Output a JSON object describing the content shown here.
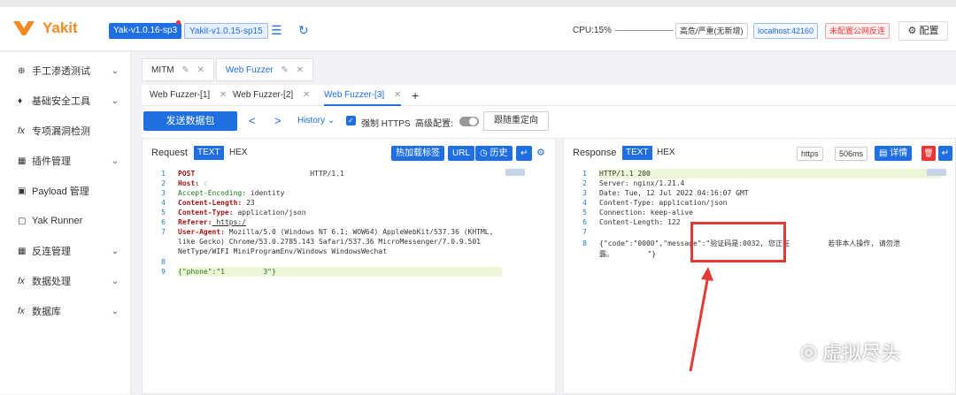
{
  "app": {
    "title": "Yakit",
    "version_current": "Yak-v1.0.16-sp3",
    "version_other": "Yakit-v1.0.15-sp15",
    "cpu": "CPU:15%",
    "risk_chip": "高危/严重(无新增)",
    "host_chip": "localhost:42160",
    "warn_chip": "未配置公网反连",
    "config_label": "配置"
  },
  "sidebar": {
    "items": [
      {
        "label": "手工渗透测试",
        "icon": "crosshair-icon",
        "chevron": true
      },
      {
        "label": "基础安全工具",
        "icon": "tool-icon",
        "chevron": true
      },
      {
        "label": "专项漏洞检测",
        "icon": "fx-icon",
        "chevron": false
      },
      {
        "label": "插件管理",
        "icon": "grid-icon",
        "chevron": true
      },
      {
        "label": "Payload 管理",
        "icon": "payload-icon",
        "chevron": false
      },
      {
        "label": "Yak Runner",
        "icon": "terminal-icon",
        "chevron": false
      },
      {
        "label": "反连管理",
        "icon": "grid-icon",
        "chevron": true
      },
      {
        "label": "数据处理",
        "icon": "fx-icon",
        "chevron": true
      },
      {
        "label": "数据库",
        "icon": "fx-icon",
        "chevron": true
      }
    ]
  },
  "tabs_top": [
    {
      "label": "MITM"
    },
    {
      "label": "Web Fuzzer",
      "active": true
    }
  ],
  "tabs_sub": [
    {
      "label": "Web Fuzzer-[1]"
    },
    {
      "label": "Web Fuzzer-[2]"
    },
    {
      "label": "Web Fuzzer-[3]",
      "active": true
    }
  ],
  "toolbar": {
    "send_label": "发送数据包",
    "history_label": "History",
    "force_https_label": "强制 HTTPS",
    "advanced_label": "高级配置:",
    "follow_redirect_label": "跟随重定向"
  },
  "request": {
    "title": "Request",
    "seg_text": "TEXT",
    "seg_hex": "HEX",
    "btn_hotload": "热加载标签",
    "btn_url": "URL",
    "btn_history": "历史",
    "lines": [
      {
        "n": "1",
        "key": "POST",
        "val": "                           HTTP/1.1"
      },
      {
        "n": "2",
        "key": "Host:",
        "val": " c"
      },
      {
        "n": "3",
        "key": "Accept-Encoding:",
        "val": " identity"
      },
      {
        "n": "4",
        "key": "Content-Length:",
        "val": " 23"
      },
      {
        "n": "5",
        "key": "Content-Type:",
        "val": " application/json"
      },
      {
        "n": "6",
        "key": "Referer:",
        "val": " https:/"
      },
      {
        "n": "7",
        "key": "User-Agent:",
        "val": " Mozilla/5.0 (Windows NT 6.1; WOW64) AppleWebKit/537.36 (KHTML,"
      },
      {
        "n": "",
        "key": "",
        "val": "like Gecko) Chrome/53.0.2785.143 Safari/537.36 MicroMessenger/7.0.9.501"
      },
      {
        "n": "",
        "key": "",
        "val": "NetType/WIFI MiniProgramEnv/Windows WindowsWechat"
      },
      {
        "n": "8",
        "key": "",
        "val": ""
      },
      {
        "n": "9",
        "key": "",
        "val": "{\"phone\":\"1         3\"}"
      }
    ]
  },
  "response": {
    "title": "Response",
    "seg_text": "TEXT",
    "seg_hex": "HEX",
    "chip_proto": "https",
    "chip_time": "506ms",
    "btn_detail": "详情",
    "lines": [
      {
        "n": "1",
        "val": "HTTP/1.1 200"
      },
      {
        "n": "2",
        "val": "Server: nginx/1.21.4"
      },
      {
        "n": "3",
        "val": "Date: Tue, 12 Jul 2022 04:16:07 GMT"
      },
      {
        "n": "4",
        "val": "Content-Type: application/json"
      },
      {
        "n": "5",
        "val": "Connection: keep-alive"
      },
      {
        "n": "6",
        "val": "Content-Length: 122"
      },
      {
        "n": "7",
        "val": ""
      },
      {
        "n": "8",
        "val": "{\"code\":\"0000\",\"message\":\"验证码是:0032, 您正在         若非本人操作, 请勿泄"
      },
      {
        "n": "",
        "val": "露。        \"}"
      }
    ]
  },
  "watermark": "虚拟尽头"
}
